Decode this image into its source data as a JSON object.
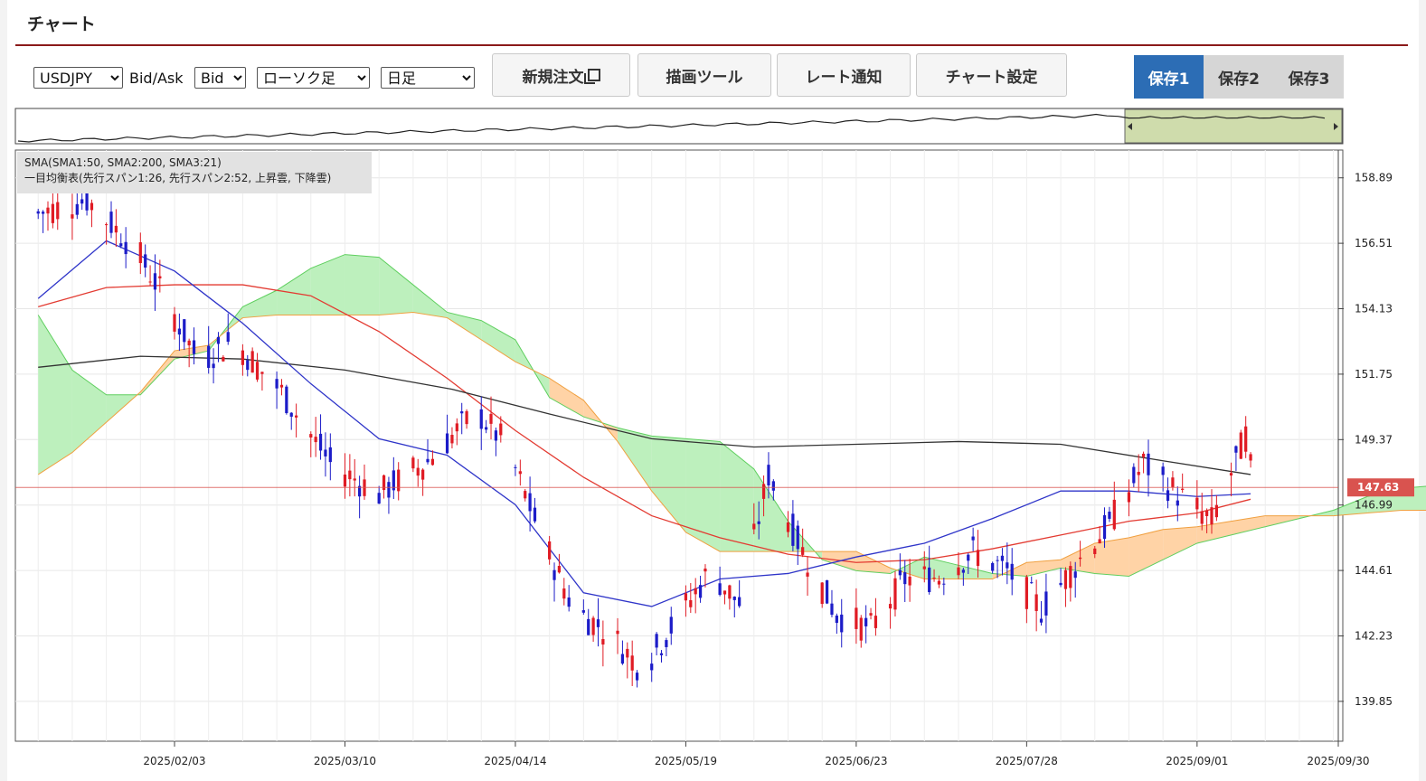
{
  "header": {
    "title": "チャート"
  },
  "toolbar": {
    "symbol": "USDJPY",
    "bid_ask_label": "Bid/Ask",
    "bid_ask_value": "Bid",
    "chart_type": "ローソク足",
    "timeframe": "日足",
    "buttons": {
      "new_order": "新規注文",
      "drawing_tools": "描画ツール",
      "rate_alert": "レート通知",
      "chart_settings": "チャート設定"
    },
    "saves": [
      "保存1",
      "保存2",
      "保存3"
    ],
    "active_save": "保存1"
  },
  "colors": {
    "bull": "#1c1cc8",
    "bear": "#e01b24",
    "sma_short": "#2f35c9",
    "sma_mid": "#e33b32",
    "sma_long": "#333333",
    "cloud_up": "#bdf0bd",
    "cloud_down": "#ffd3a6",
    "price_marker": "#d9534f",
    "active_save_bg": "#2c6db5"
  },
  "legend": {
    "line1": "SMA(SMA1:50, SMA2:200, SMA3:21)",
    "line2": "一目均衡表(先行スパン1:26, 先行スパン2:52, 上昇雲, 下降雲)"
  },
  "chart_data": {
    "type": "candlestick",
    "yticks": [
      158.89,
      156.51,
      154.13,
      151.75,
      149.37,
      146.99,
      144.61,
      142.23,
      139.85
    ],
    "ylim": [
      138.4,
      159.9
    ],
    "xticks": [
      "2025/02/03",
      "2025/03/10",
      "2025/04/14",
      "2025/05/19",
      "2025/06/23",
      "2025/07/28",
      "2025/09/01",
      "2025/09/30"
    ],
    "current_price": "147.63",
    "series": [
      {
        "name": "SMA1:50",
        "x": [
          "2025/01/06",
          "2025/01/20",
          "2025/02/03",
          "2025/02/17",
          "2025/03/03",
          "2025/03/17",
          "2025/03/31",
          "2025/04/14",
          "2025/04/28",
          "2025/05/12",
          "2025/05/26",
          "2025/06/09",
          "2025/06/23",
          "2025/07/07",
          "2025/07/21",
          "2025/08/04",
          "2025/08/18",
          "2025/09/01",
          "2025/09/12"
        ],
        "y": [
          154.2,
          154.9,
          155.0,
          155.0,
          154.6,
          153.3,
          151.6,
          149.7,
          148.0,
          146.6,
          145.8,
          145.2,
          144.9,
          145.0,
          145.4,
          145.9,
          146.4,
          146.7,
          147.2
        ]
      },
      {
        "name": "SMA2:200",
        "x": [
          "2025/01/06",
          "2025/01/27",
          "2025/02/17",
          "2025/03/10",
          "2025/04/01",
          "2025/04/21",
          "2025/05/12",
          "2025/06/02",
          "2025/06/23",
          "2025/07/14",
          "2025/08/04",
          "2025/08/25",
          "2025/09/12"
        ],
        "y": [
          152.0,
          152.4,
          152.3,
          151.9,
          151.2,
          150.3,
          149.4,
          149.1,
          149.2,
          149.3,
          149.2,
          148.6,
          148.1
        ]
      },
      {
        "name": "SMA3:21",
        "x": [
          "2025/01/06",
          "2025/01/20",
          "2025/02/03",
          "2025/02/17",
          "2025/03/03",
          "2025/03/17",
          "2025/03/31",
          "2025/04/14",
          "2025/04/28",
          "2025/05/12",
          "2025/05/26",
          "2025/06/09",
          "2025/06/23",
          "2025/07/07",
          "2025/07/21",
          "2025/08/04",
          "2025/08/18",
          "2025/09/01",
          "2025/09/12"
        ],
        "y": [
          154.5,
          156.6,
          155.5,
          153.6,
          151.4,
          149.4,
          148.8,
          147.0,
          143.8,
          143.3,
          144.3,
          144.5,
          145.1,
          145.6,
          146.5,
          147.5,
          147.5,
          147.3,
          147.4
        ]
      }
    ],
    "xlabel": "",
    "ylabel": ""
  }
}
